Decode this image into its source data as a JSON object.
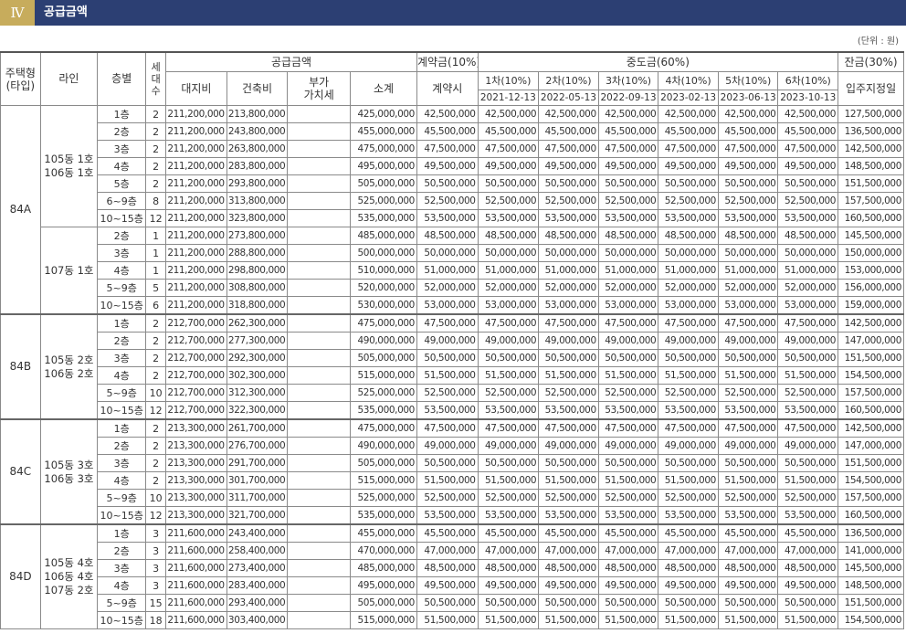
{
  "header": {
    "roman": "Ⅳ",
    "title": "공급금액"
  },
  "unit": "(단위 : 원)",
  "columns": {
    "type": "주택형\n(타입)",
    "line": "라인",
    "floor": "층별",
    "count": "세\n대\n수",
    "supply_group": "공급금액",
    "land": "대지비",
    "building": "건축비",
    "vat": "부가\n가치세",
    "subtotal": "소계",
    "contract_group": "계약금(10%)",
    "contract_when": "계약시",
    "middle_group": "중도금(60%)",
    "middle": [
      {
        "label": "1차(10%)",
        "date": "2021-12-13"
      },
      {
        "label": "2차(10%)",
        "date": "2022-05-13"
      },
      {
        "label": "3차(10%)",
        "date": "2022-09-13"
      },
      {
        "label": "4차(10%)",
        "date": "2023-02-13"
      },
      {
        "label": "5차(10%)",
        "date": "2023-06-13"
      },
      {
        "label": "6차(10%)",
        "date": "2023-10-13"
      }
    ],
    "balance_group": "잔금(30%)",
    "balance_when": "입주지정일"
  },
  "groups": [
    {
      "type": "84A",
      "lines": [
        {
          "label": "105동 1호\n106동 1호",
          "rows": [
            {
              "floor": "1층",
              "count": "2",
              "land": "211,200,000",
              "building": "213,800,000",
              "vat": "",
              "subtotal": "425,000,000",
              "contract": "42,500,000",
              "mid": "42,500,000",
              "balance": "127,500,000"
            },
            {
              "floor": "2층",
              "count": "2",
              "land": "211,200,000",
              "building": "243,800,000",
              "vat": "",
              "subtotal": "455,000,000",
              "contract": "45,500,000",
              "mid": "45,500,000",
              "balance": "136,500,000"
            },
            {
              "floor": "3층",
              "count": "2",
              "land": "211,200,000",
              "building": "263,800,000",
              "vat": "",
              "subtotal": "475,000,000",
              "contract": "47,500,000",
              "mid": "47,500,000",
              "balance": "142,500,000"
            },
            {
              "floor": "4층",
              "count": "2",
              "land": "211,200,000",
              "building": "283,800,000",
              "vat": "",
              "subtotal": "495,000,000",
              "contract": "49,500,000",
              "mid": "49,500,000",
              "balance": "148,500,000"
            },
            {
              "floor": "5층",
              "count": "2",
              "land": "211,200,000",
              "building": "293,800,000",
              "vat": "",
              "subtotal": "505,000,000",
              "contract": "50,500,000",
              "mid": "50,500,000",
              "balance": "151,500,000"
            },
            {
              "floor": "6~9층",
              "count": "8",
              "land": "211,200,000",
              "building": "313,800,000",
              "vat": "",
              "subtotal": "525,000,000",
              "contract": "52,500,000",
              "mid": "52,500,000",
              "balance": "157,500,000"
            },
            {
              "floor": "10~15층",
              "count": "12",
              "land": "211,200,000",
              "building": "323,800,000",
              "vat": "",
              "subtotal": "535,000,000",
              "contract": "53,500,000",
              "mid": "53,500,000",
              "balance": "160,500,000"
            }
          ]
        },
        {
          "label": "107동 1호",
          "rows": [
            {
              "floor": "2층",
              "count": "1",
              "land": "211,200,000",
              "building": "273,800,000",
              "vat": "",
              "subtotal": "485,000,000",
              "contract": "48,500,000",
              "mid": "48,500,000",
              "balance": "145,500,000"
            },
            {
              "floor": "3층",
              "count": "1",
              "land": "211,200,000",
              "building": "288,800,000",
              "vat": "",
              "subtotal": "500,000,000",
              "contract": "50,000,000",
              "mid": "50,000,000",
              "balance": "150,000,000"
            },
            {
              "floor": "4층",
              "count": "1",
              "land": "211,200,000",
              "building": "298,800,000",
              "vat": "",
              "subtotal": "510,000,000",
              "contract": "51,000,000",
              "mid": "51,000,000",
              "balance": "153,000,000"
            },
            {
              "floor": "5~9층",
              "count": "5",
              "land": "211,200,000",
              "building": "308,800,000",
              "vat": "",
              "subtotal": "520,000,000",
              "contract": "52,000,000",
              "mid": "52,000,000",
              "balance": "156,000,000"
            },
            {
              "floor": "10~15층",
              "count": "6",
              "land": "211,200,000",
              "building": "318,800,000",
              "vat": "",
              "subtotal": "530,000,000",
              "contract": "53,000,000",
              "mid": "53,000,000",
              "balance": "159,000,000"
            }
          ]
        }
      ]
    },
    {
      "type": "84B",
      "lines": [
        {
          "label": "105동 2호\n106동 2호",
          "rows": [
            {
              "floor": "1층",
              "count": "2",
              "land": "212,700,000",
              "building": "262,300,000",
              "vat": "",
              "subtotal": "475,000,000",
              "contract": "47,500,000",
              "mid": "47,500,000",
              "balance": "142,500,000"
            },
            {
              "floor": "2층",
              "count": "2",
              "land": "212,700,000",
              "building": "277,300,000",
              "vat": "",
              "subtotal": "490,000,000",
              "contract": "49,000,000",
              "mid": "49,000,000",
              "balance": "147,000,000"
            },
            {
              "floor": "3층",
              "count": "2",
              "land": "212,700,000",
              "building": "292,300,000",
              "vat": "",
              "subtotal": "505,000,000",
              "contract": "50,500,000",
              "mid": "50,500,000",
              "balance": "151,500,000"
            },
            {
              "floor": "4층",
              "count": "2",
              "land": "212,700,000",
              "building": "302,300,000",
              "vat": "",
              "subtotal": "515,000,000",
              "contract": "51,500,000",
              "mid": "51,500,000",
              "balance": "154,500,000"
            },
            {
              "floor": "5~9층",
              "count": "10",
              "land": "212,700,000",
              "building": "312,300,000",
              "vat": "",
              "subtotal": "525,000,000",
              "contract": "52,500,000",
              "mid": "52,500,000",
              "balance": "157,500,000"
            },
            {
              "floor": "10~15층",
              "count": "12",
              "land": "212,700,000",
              "building": "322,300,000",
              "vat": "",
              "subtotal": "535,000,000",
              "contract": "53,500,000",
              "mid": "53,500,000",
              "balance": "160,500,000"
            }
          ]
        }
      ]
    },
    {
      "type": "84C",
      "lines": [
        {
          "label": "105동 3호\n106동 3호",
          "rows": [
            {
              "floor": "1층",
              "count": "2",
              "land": "213,300,000",
              "building": "261,700,000",
              "vat": "",
              "subtotal": "475,000,000",
              "contract": "47,500,000",
              "mid": "47,500,000",
              "balance": "142,500,000"
            },
            {
              "floor": "2층",
              "count": "2",
              "land": "213,300,000",
              "building": "276,700,000",
              "vat": "",
              "subtotal": "490,000,000",
              "contract": "49,000,000",
              "mid": "49,000,000",
              "balance": "147,000,000"
            },
            {
              "floor": "3층",
              "count": "2",
              "land": "213,300,000",
              "building": "291,700,000",
              "vat": "",
              "subtotal": "505,000,000",
              "contract": "50,500,000",
              "mid": "50,500,000",
              "balance": "151,500,000"
            },
            {
              "floor": "4층",
              "count": "2",
              "land": "213,300,000",
              "building": "301,700,000",
              "vat": "",
              "subtotal": "515,000,000",
              "contract": "51,500,000",
              "mid": "51,500,000",
              "balance": "154,500,000"
            },
            {
              "floor": "5~9층",
              "count": "10",
              "land": "213,300,000",
              "building": "311,700,000",
              "vat": "",
              "subtotal": "525,000,000",
              "contract": "52,500,000",
              "mid": "52,500,000",
              "balance": "157,500,000"
            },
            {
              "floor": "10~15층",
              "count": "12",
              "land": "213,300,000",
              "building": "321,700,000",
              "vat": "",
              "subtotal": "535,000,000",
              "contract": "53,500,000",
              "mid": "53,500,000",
              "balance": "160,500,000"
            }
          ]
        }
      ]
    },
    {
      "type": "84D",
      "lines": [
        {
          "label": "105동 4호\n106동 4호\n107동 2호",
          "rows": [
            {
              "floor": "1층",
              "count": "3",
              "land": "211,600,000",
              "building": "243,400,000",
              "vat": "",
              "subtotal": "455,000,000",
              "contract": "45,500,000",
              "mid": "45,500,000",
              "balance": "136,500,000"
            },
            {
              "floor": "2층",
              "count": "3",
              "land": "211,600,000",
              "building": "258,400,000",
              "vat": "",
              "subtotal": "470,000,000",
              "contract": "47,000,000",
              "mid": "47,000,000",
              "balance": "141,000,000"
            },
            {
              "floor": "3층",
              "count": "3",
              "land": "211,600,000",
              "building": "273,400,000",
              "vat": "",
              "subtotal": "485,000,000",
              "contract": "48,500,000",
              "mid": "48,500,000",
              "balance": "145,500,000"
            },
            {
              "floor": "4층",
              "count": "3",
              "land": "211,600,000",
              "building": "283,400,000",
              "vat": "",
              "subtotal": "495,000,000",
              "contract": "49,500,000",
              "mid": "49,500,000",
              "balance": "148,500,000"
            },
            {
              "floor": "5~9층",
              "count": "15",
              "land": "211,600,000",
              "building": "293,400,000",
              "vat": "",
              "subtotal": "505,000,000",
              "contract": "50,500,000",
              "mid": "50,500,000",
              "balance": "151,500,000"
            },
            {
              "floor": "10~15층",
              "count": "18",
              "land": "211,600,000",
              "building": "303,400,000",
              "vat": "",
              "subtotal": "515,000,000",
              "contract": "51,500,000",
              "mid": "51,500,000",
              "balance": "154,500,000"
            }
          ]
        }
      ]
    }
  ]
}
